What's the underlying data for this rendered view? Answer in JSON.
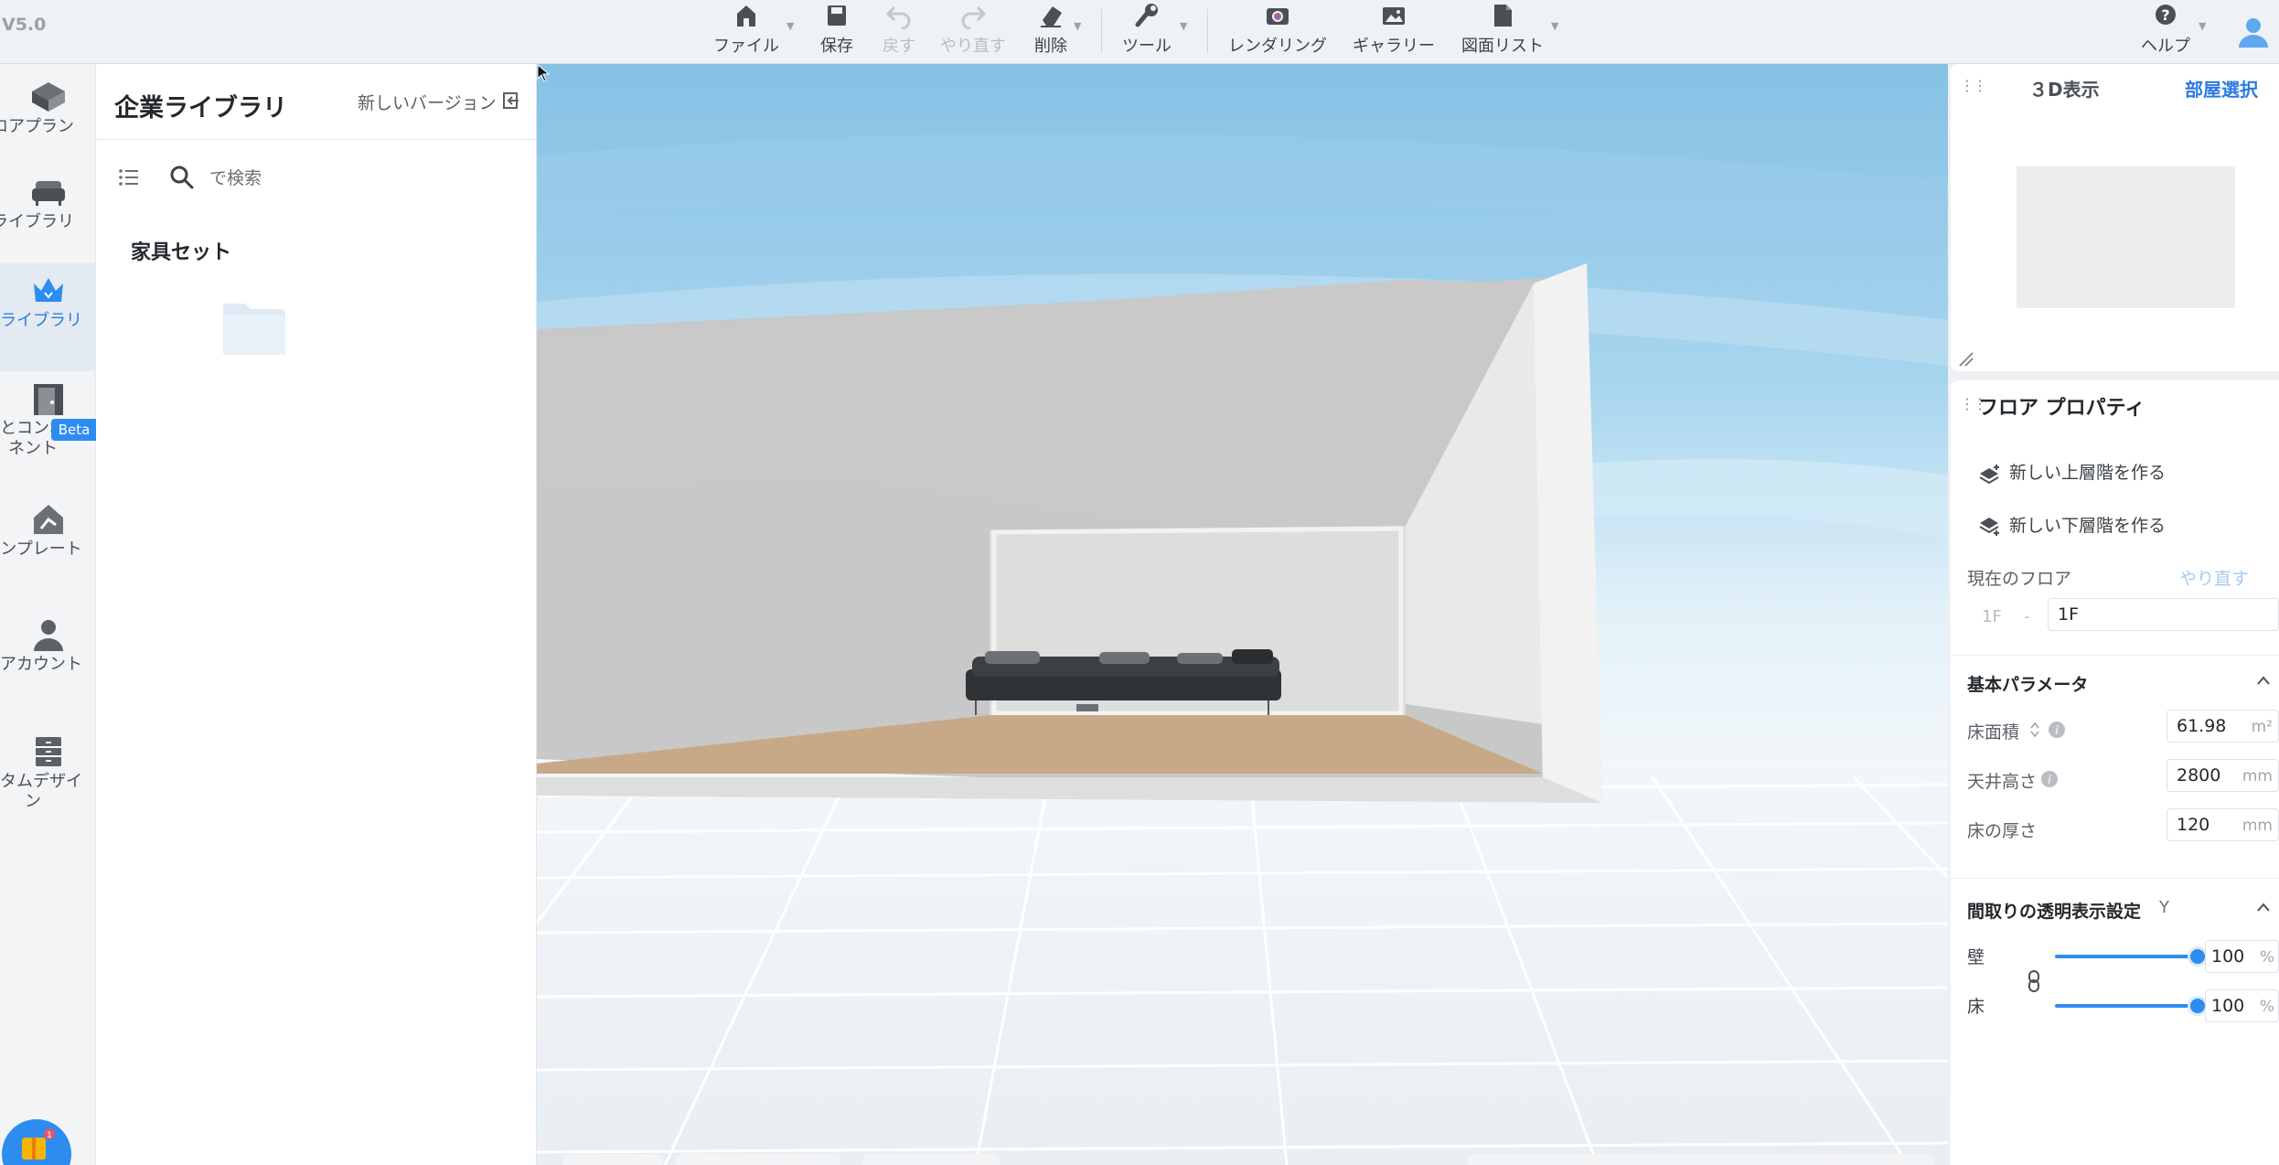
{
  "app": {
    "version": "V5.0"
  },
  "toolbar": {
    "file": "ファイル",
    "save": "保存",
    "undo": "戻す",
    "redo": "やり直す",
    "delete": "削除",
    "tools": "ツール",
    "rendering": "レンダリング",
    "gallery": "ギャラリー",
    "drawing_list": "図面リスト",
    "help": "ヘルプ"
  },
  "rail": {
    "items": [
      {
        "label": "ロアプラン",
        "icon": "floorplan-icon"
      },
      {
        "label": "ライブラリ",
        "icon": "sofa-icon"
      },
      {
        "label": "業ライブラリ",
        "icon": "crown-icon"
      },
      {
        "label": "料とコンポーネント",
        "icon": "door-icon"
      },
      {
        "label": "テンプレート",
        "icon": "template-icon"
      },
      {
        "label": "イアカウント",
        "icon": "user-icon"
      },
      {
        "label": "スタムデザイン",
        "icon": "cabinet-icon"
      }
    ],
    "badge": "Beta"
  },
  "library": {
    "title": "企業ライブラリ",
    "new_version": "新しいバージョン",
    "search_placeholder": "で検索",
    "section": "家具セット"
  },
  "view3d": {
    "title": "３D表示",
    "room_select": "部屋選択"
  },
  "floor_props": {
    "title": "フロア プロパティ",
    "new_upper": "新しい上層階を作る",
    "new_lower": "新しい下層階を作る",
    "current_floor_label": "現在のフロア",
    "redo_label": "やり直す",
    "floor_prefix": "1F",
    "floor_name": "1F",
    "basic_params": "基本パラメータ",
    "floor_area_label": "床面積",
    "floor_area_value": "61.98",
    "floor_area_unit": "m²",
    "ceiling_label": "天井高さ",
    "ceiling_value": "2800",
    "ceiling_unit": "mm",
    "thickness_label": "床の厚さ",
    "thickness_value": "120",
    "thickness_unit": "mm",
    "transparency_title": "間取りの透明表示設定",
    "transparency_key": "Y",
    "wall_label": "壁",
    "wall_value": "100",
    "floor_label": "床",
    "floor_value": "100",
    "percent": "%"
  },
  "colors": {
    "accent": "#2d8cf0",
    "sky": "#8fc6e6"
  }
}
